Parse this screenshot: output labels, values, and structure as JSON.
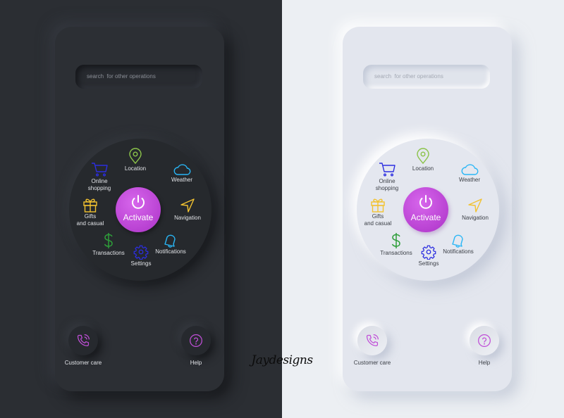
{
  "themes": [
    {
      "name": "dark",
      "search": {
        "placeholder": "search  for other operations"
      },
      "activate": {
        "label": "Activate",
        "icon": "power-icon"
      },
      "menu": [
        {
          "label": "Location",
          "icon": "map-pin-icon",
          "color": "#8bc34a"
        },
        {
          "label": "Weather",
          "icon": "cloud-icon",
          "color": "#29b6f6"
        },
        {
          "label": "Navigation",
          "icon": "navigation-arrow-icon",
          "color": "#f2c230"
        },
        {
          "label": "Notifications",
          "icon": "bell-icon",
          "color": "#29b6f6"
        },
        {
          "label": "Settings",
          "icon": "gear-icon",
          "color": "#2c2ee0"
        },
        {
          "label": "Transactions",
          "icon": "dollar-icon",
          "color": "#2e9e3a"
        },
        {
          "label_line1": "Gifts",
          "label_line2": "and casual",
          "icon": "gift-icon",
          "color": "#f2c230"
        },
        {
          "label_line1": "Online",
          "label_line2": "shopping",
          "icon": "cart-icon",
          "color": "#2c2ee0"
        }
      ],
      "bottom": {
        "customer_care": {
          "label": "Customer care",
          "icon": "phone-call-icon"
        },
        "help": {
          "label": "Help",
          "icon": "question-circle-icon"
        }
      }
    },
    {
      "name": "light",
      "search": {
        "placeholder": "search  for other operations"
      },
      "activate": {
        "label": "Activate",
        "icon": "power-icon"
      },
      "menu": [
        {
          "label": "Location",
          "icon": "map-pin-icon",
          "color": "#8bc34a"
        },
        {
          "label": "Weather",
          "icon": "cloud-icon",
          "color": "#29b6f6"
        },
        {
          "label": "Navigation",
          "icon": "navigation-arrow-icon",
          "color": "#f2c230"
        },
        {
          "label": "Notifications",
          "icon": "bell-icon",
          "color": "#29b6f6"
        },
        {
          "label": "Settings",
          "icon": "gear-icon",
          "color": "#2c2ee0"
        },
        {
          "label": "Transactions",
          "icon": "dollar-icon",
          "color": "#2e9e3a"
        },
        {
          "label_line1": "Gifts",
          "label_line2": "and casual",
          "icon": "gift-icon",
          "color": "#f2c230"
        },
        {
          "label_line1": "Online",
          "label_line2": "shopping",
          "icon": "cart-icon",
          "color": "#2c2ee0"
        }
      ],
      "bottom": {
        "customer_care": {
          "label": "Customer care",
          "icon": "phone-call-icon"
        },
        "help": {
          "label": "Help",
          "icon": "question-circle-icon"
        }
      }
    }
  ],
  "colors": {
    "accent": "#c04fd8",
    "dark_bg": "#2b2e33",
    "light_bg": "#eceff3"
  },
  "signature": "Jaydesigns"
}
